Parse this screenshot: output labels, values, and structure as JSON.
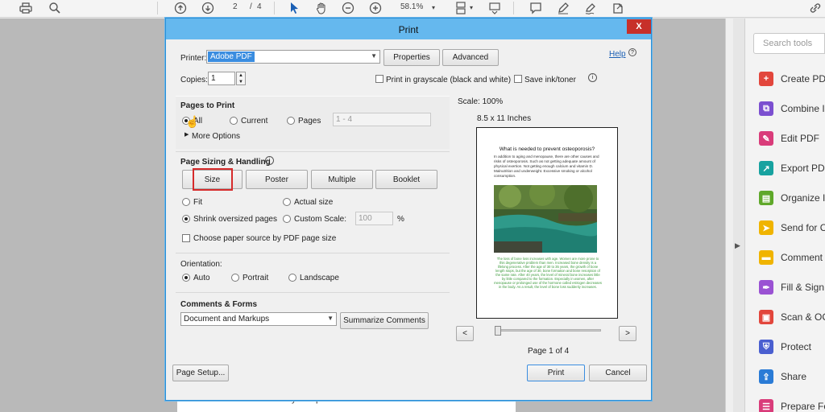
{
  "toolbar": {
    "page_current": "2",
    "page_separator": "/",
    "page_total": "4",
    "zoom": "58.1%",
    "icons": [
      "print-icon",
      "zoom-search-icon",
      "page-up-icon",
      "page-down-icon",
      "select-cursor-icon",
      "hand-icon",
      "zoom-out-icon",
      "zoom-in-icon",
      "page-layout-icon",
      "scroll-mode-icon",
      "comment-icon",
      "pen-icon",
      "sign-icon",
      "share-icon",
      "link-icon"
    ]
  },
  "background_doc": {
    "bottom_text": "bone mineral density of a patient at risk."
  },
  "tools_pane": {
    "search_placeholder": "Search tools",
    "items": [
      {
        "label": "Create PD",
        "icon": "create-pdf-icon",
        "color": "#e2463c"
      },
      {
        "label": "Combine I",
        "icon": "combine-files-icon",
        "color": "#7b4fd0"
      },
      {
        "label": "Edit PDF",
        "icon": "edit-pdf-icon",
        "color": "#d93c7a"
      },
      {
        "label": "Export PD",
        "icon": "export-pdf-icon",
        "color": "#17a2a0"
      },
      {
        "label": "Organize I",
        "icon": "organize-pages-icon",
        "color": "#5fa82a"
      },
      {
        "label": "Send for C",
        "icon": "send-for-comments-icon",
        "color": "#f0b400"
      },
      {
        "label": "Comment",
        "icon": "comment-tool-icon",
        "color": "#f0b400"
      },
      {
        "label": "Fill & Sign",
        "icon": "fill-sign-icon",
        "color": "#9a52d3"
      },
      {
        "label": "Scan & OC",
        "icon": "scan-ocr-icon",
        "color": "#e2463c"
      },
      {
        "label": "Protect",
        "icon": "protect-icon",
        "color": "#4a5fd0"
      },
      {
        "label": "Share",
        "icon": "share-tool-icon",
        "color": "#2a7bd6"
      },
      {
        "label": "Prepare Fo",
        "icon": "prepare-form-icon",
        "color": "#d93c7a"
      }
    ]
  },
  "dialog": {
    "title": "Print",
    "close_label": "X",
    "printer_label": "Printer:",
    "printer_value": "Adobe PDF",
    "properties_label": "Properties",
    "advanced_label": "Advanced",
    "help_label": "Help",
    "copies_label": "Copies:",
    "copies_value": "1",
    "grayscale_label": "Print in grayscale (black and white)",
    "save_ink_label": "Save ink/toner",
    "pages_to_print": {
      "heading": "Pages to Print",
      "all_label": "All",
      "current_label": "Current",
      "pages_label": "Pages",
      "pages_range": "1 - 4",
      "more_options": "More Options"
    },
    "sizing": {
      "heading": "Page Sizing & Handling",
      "tabs": [
        "Size",
        "Poster",
        "Multiple",
        "Booklet"
      ],
      "fit_label": "Fit",
      "actual_size_label": "Actual size",
      "shrink_label": "Shrink oversized pages",
      "custom_scale_label": "Custom Scale:",
      "custom_scale_value": "100",
      "percent": "%",
      "paper_source_label": "Choose paper source by PDF page size"
    },
    "orientation": {
      "heading": "Orientation:",
      "auto_label": "Auto",
      "portrait_label": "Portrait",
      "landscape_label": "Landscape"
    },
    "comments_forms": {
      "heading": "Comments & Forms",
      "value": "Document and Markups",
      "summarize_label": "Summarize Comments"
    },
    "preview": {
      "scale": "Scale: 100%",
      "paper_size": "8.5 x 11 Inches",
      "doc_title": "What is needed to prevent osteoporosis?",
      "doc_body": "In addition to aging and menopause, there are other causes and risks of osteoporosis. Such as not getting adequate amount of physical exertion. Not getting enough calcium and vitamin D. Malnutrition and underweight. Excessive smoking or alcohol consumption.",
      "doc_green": "The loss of bone loss increases with age. Women are more prone to this degenerative problem than men. Increased bone density is a lifelong process. After the age of 30 to 35 years, the growth of bone length stops, but the age of 30, bone formation and bone resorption of the same rate. After 40 years, the level of mineral bone increases little by little compared to the formation. Especially in women, after menopause or prolonged use of the hormone called estrogen decreases in the body. As a result, the level of bone loss suddenly increases.",
      "prev_label": "<",
      "next_label": ">",
      "page_indicator": "Page 1 of 4"
    },
    "page_setup_label": "Page Setup...",
    "print_label": "Print",
    "cancel_label": "Cancel"
  }
}
